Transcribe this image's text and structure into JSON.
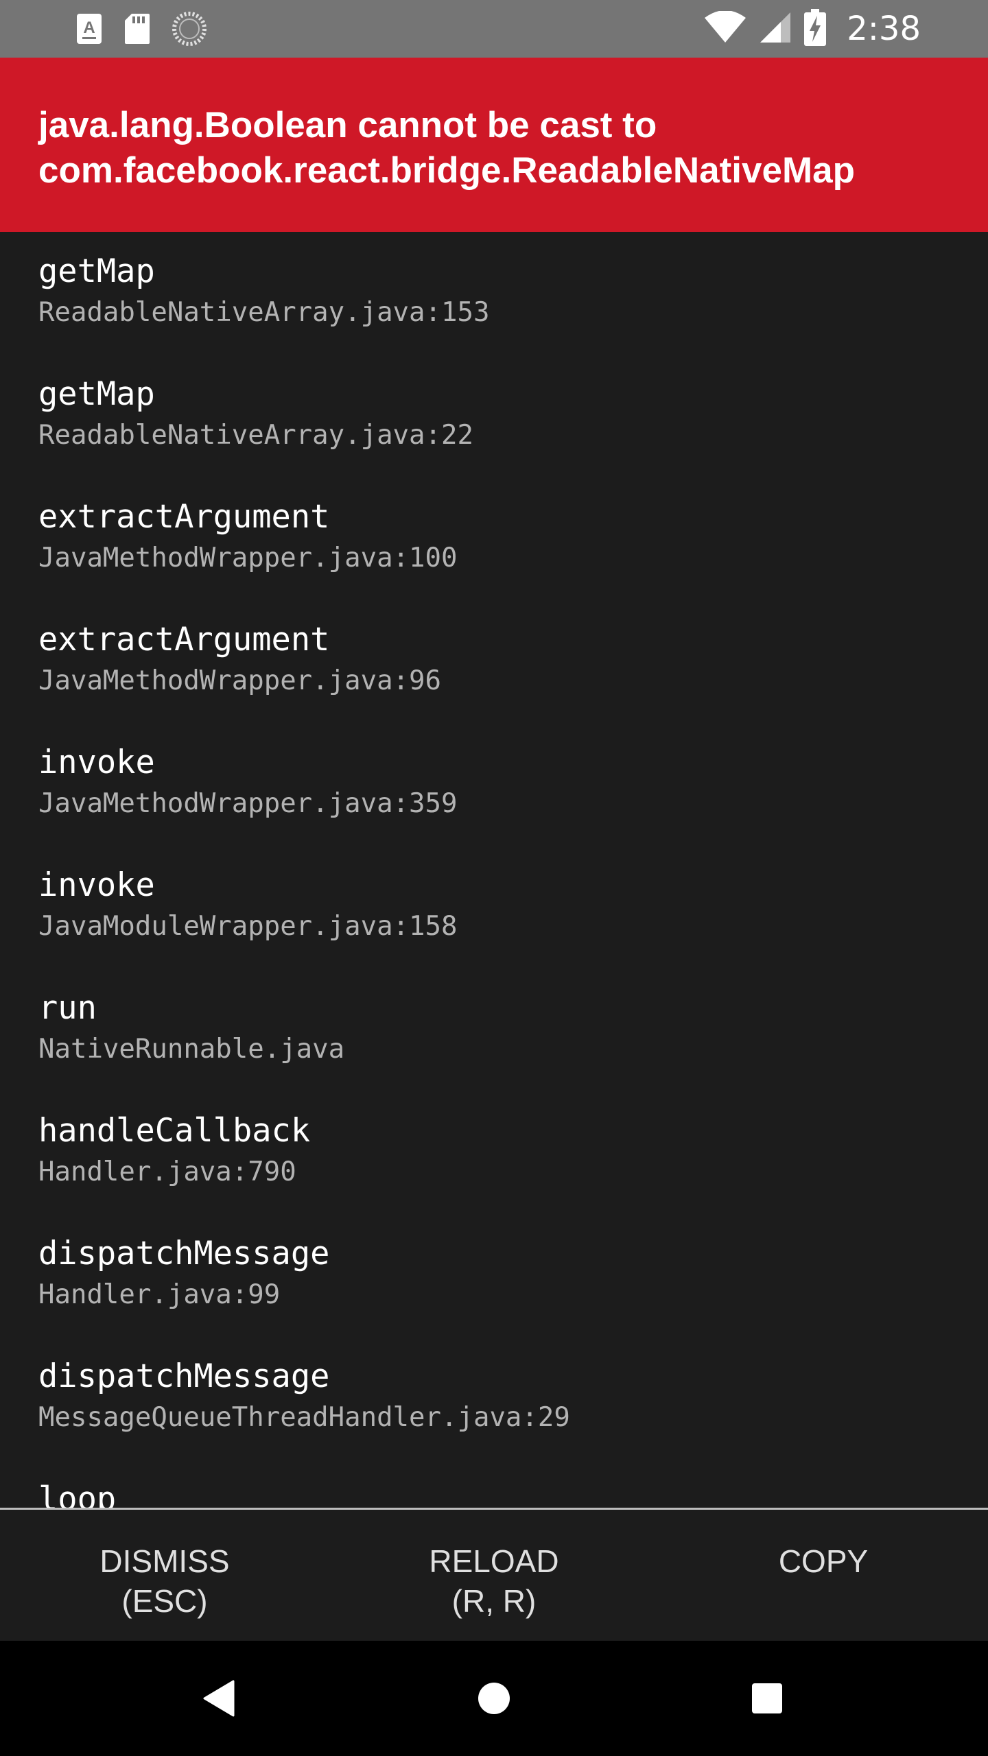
{
  "status_bar": {
    "time": "2:38",
    "left_icons": [
      "text-a-notification-icon",
      "sd-card-icon",
      "sync-spinner-icon"
    ],
    "right_icons": [
      "wifi-icon",
      "cell-signal-icon",
      "battery-charging-icon"
    ]
  },
  "error": {
    "message": "java.lang.Boolean cannot be cast to\ncom.facebook.react.bridge.ReadableNativeMap",
    "header_color": "#cf1827"
  },
  "stack_frames": [
    {
      "method": "getMap",
      "location": "ReadableNativeArray.java:153"
    },
    {
      "method": "getMap",
      "location": "ReadableNativeArray.java:22"
    },
    {
      "method": "extractArgument",
      "location": "JavaMethodWrapper.java:100"
    },
    {
      "method": "extractArgument",
      "location": "JavaMethodWrapper.java:96"
    },
    {
      "method": "invoke",
      "location": "JavaMethodWrapper.java:359"
    },
    {
      "method": "invoke",
      "location": "JavaModuleWrapper.java:158"
    },
    {
      "method": "run",
      "location": "NativeRunnable.java"
    },
    {
      "method": "handleCallback",
      "location": "Handler.java:790"
    },
    {
      "method": "dispatchMessage",
      "location": "Handler.java:99"
    },
    {
      "method": "dispatchMessage",
      "location": "MessageQueueThreadHandler.java:29"
    },
    {
      "method": "loop",
      "location": ""
    }
  ],
  "actions": {
    "dismiss": "DISMISS\n(ESC)",
    "reload": "RELOAD\n(R, R)",
    "copy": "COPY"
  },
  "nav_bar": {
    "icons": [
      "back-icon",
      "home-icon",
      "recents-icon"
    ]
  }
}
